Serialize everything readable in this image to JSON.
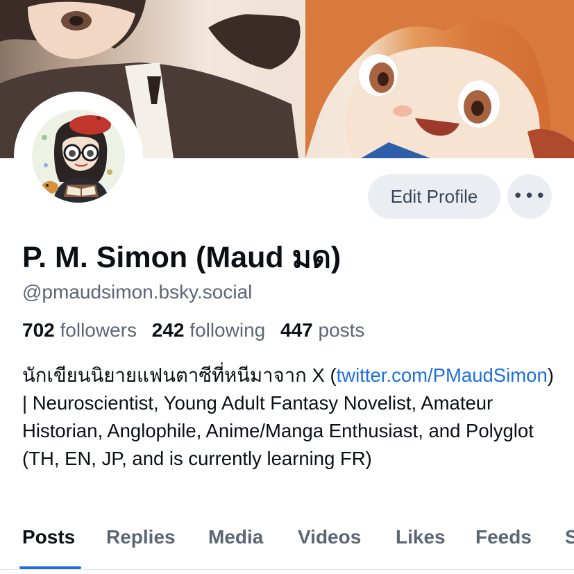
{
  "profile": {
    "display_name": "P. M. Simon (Maud มด)",
    "handle": "@pmaudsimon.bsky.social"
  },
  "actions": {
    "edit_profile_label": "Edit Profile",
    "more_label": "•••"
  },
  "stats": {
    "followers_count": "702",
    "followers_label": "followers",
    "following_count": "242",
    "following_label": "following",
    "posts_count": "447",
    "posts_label": "posts"
  },
  "bio": {
    "text_before_link": "นักเขียนนิยายแฟนตาซีที่หนีมาจาก X (",
    "link_text": "twitter.com/PMaudSimon",
    "text_after_link": ") | Neuroscientist, Young Adult Fantasy Novelist, Amateur Historian, Anglophile, Anime/Manga Enthusiast, and Polyglot (TH, EN, JP, and is currently learning FR)"
  },
  "tabs": [
    {
      "label": "Posts",
      "active": true
    },
    {
      "label": "Replies",
      "active": false
    },
    {
      "label": "Media",
      "active": false
    },
    {
      "label": "Videos",
      "active": false
    },
    {
      "label": "Likes",
      "active": false
    },
    {
      "label": "Feeds",
      "active": false
    },
    {
      "label": "S",
      "active": false
    }
  ],
  "colors": {
    "link": "#1c6fe3",
    "button_bg": "#eaeef3",
    "muted_text": "#5b6675",
    "tab_indicator": "#1c6fe3"
  },
  "icons": {
    "more": "ellipsis-horizontal-icon"
  }
}
